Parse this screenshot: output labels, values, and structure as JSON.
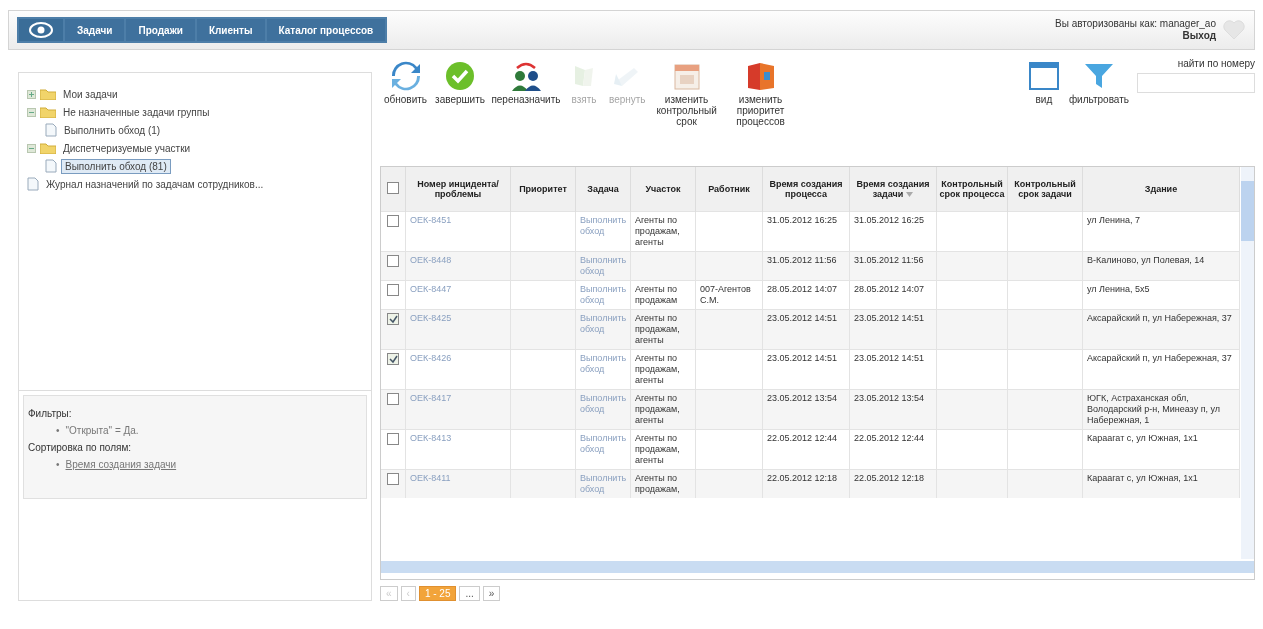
{
  "nav": {
    "tabs": [
      {
        "label": "Задачи",
        "selected": false
      },
      {
        "label": "Продажи",
        "selected": false
      },
      {
        "label": "Клиенты",
        "selected": false
      },
      {
        "label": "Каталог процессов",
        "selected": false
      }
    ]
  },
  "user": {
    "text": "Вы авторизованы как: manager_ao",
    "logout": "Выход"
  },
  "tree": [
    {
      "label": "Мои задачи",
      "kind": "folder",
      "expanded": false,
      "selected": false
    },
    {
      "label": "Не назначенные задачи группы",
      "kind": "folder",
      "expanded": true,
      "selected": false,
      "children": [
        {
          "label": "Выполнить обход (1)",
          "kind": "doc",
          "selected": false
        }
      ]
    },
    {
      "label": "Диспетчеризуемые участки",
      "kind": "folder",
      "expanded": true,
      "selected": false,
      "children": [
        {
          "label": "Выполнить обход (81)",
          "kind": "doc",
          "selected": true
        }
      ]
    },
    {
      "label": "Журнал назначений по задачам сотрудников...",
      "kind": "doc",
      "selected": false
    }
  ],
  "filters": {
    "title": "Фильтры:",
    "items": [
      {
        "marker": "•",
        "text": "\"Открыта\" = Да."
      }
    ],
    "sort_title": "Сортировка по полям:",
    "sort_items": [
      {
        "marker": "•",
        "text": "Время создания задачи"
      }
    ]
  },
  "toolbar": [
    {
      "label": "обновить",
      "kind": "refresh",
      "disabled": false
    },
    {
      "label": "завершить",
      "kind": "done",
      "disabled": false
    },
    {
      "label": "переназначить",
      "kind": "reassign",
      "disabled": false
    },
    {
      "label": "взять",
      "kind": "take",
      "disabled": true
    },
    {
      "label": "вернуть",
      "kind": "return",
      "disabled": true
    },
    {
      "label": "изменить контрольный срок",
      "kind": "calendar",
      "disabled": false
    },
    {
      "label": "изменить приоритет процессов",
      "kind": "priority",
      "disabled": false
    }
  ],
  "toolbar_right": [
    {
      "label": "вид",
      "kind": "view",
      "disabled": false
    },
    {
      "label": "фильтровать",
      "kind": "filter",
      "disabled": false
    }
  ],
  "search": {
    "label": "найти по номеру"
  },
  "table": {
    "all_checked": false,
    "columns": [
      {
        "label": "Номер инцидента/проблемы",
        "sorted": false
      },
      {
        "label": "Приоритет",
        "sorted": false
      },
      {
        "label": "Задача",
        "sorted": false
      },
      {
        "label": "Участок",
        "sorted": false
      },
      {
        "label": "Работник",
        "sorted": false
      },
      {
        "label": "Время создания процесса",
        "sorted": false
      },
      {
        "label": "Время создания задачи",
        "sorted": true
      },
      {
        "label": "Контрольный срок процесса",
        "sorted": false
      },
      {
        "label": "Контрольный срок задачи",
        "sorted": false
      },
      {
        "label": "Здание",
        "sorted": false
      }
    ],
    "rows": [
      {
        "checked": false,
        "number": "ОЕК-8451",
        "task": "Выполнить обход",
        "section": "Агенты по продажам, агенты",
        "worker": "",
        "process_time": "31.05.2012 16:25",
        "task_time": "31.05.2012 16:25",
        "building": "ул Ленина, 7"
      },
      {
        "checked": false,
        "number": "ОЕК-8448",
        "task": "Выполнить обход",
        "section": "",
        "worker": "",
        "process_time": "31.05.2012 11:56",
        "task_time": "31.05.2012 11:56",
        "building": "В-Калиново, ул Полевая, 14"
      },
      {
        "checked": false,
        "number": "ОЕК-8447",
        "task": "Выполнить обход",
        "section": "Агенты по продажам",
        "worker": "007-Агентов С.М.",
        "process_time": "28.05.2012 14:07",
        "task_time": "28.05.2012 14:07",
        "building": "ул Ленина, 5х5"
      },
      {
        "checked": true,
        "number": "ОЕК-8425",
        "task": "Выполнить обход",
        "section": "Агенты по продажам, агенты",
        "worker": "",
        "process_time": "23.05.2012 14:51",
        "task_time": "23.05.2012 14:51",
        "building": "Аксарайский п, ул Набережная, 37"
      },
      {
        "checked": true,
        "number": "ОЕК-8426",
        "task": "Выполнить обход",
        "section": "Агенты по продажам, агенты",
        "worker": "",
        "process_time": "23.05.2012 14:51",
        "task_time": "23.05.2012 14:51",
        "building": "Аксарайский п, ул Набережная, 37"
      },
      {
        "checked": false,
        "number": "ОЕК-8417",
        "task": "Выполнить обход",
        "section": "Агенты по продажам, агенты",
        "worker": "",
        "process_time": "23.05.2012 13:54",
        "task_time": "23.05.2012 13:54",
        "building": "ЮГК, Астраханская обл, Володарский р-н, Минеазу п, ул Набережная, 1"
      },
      {
        "checked": false,
        "number": "ОЕК-8413",
        "task": "Выполнить обход",
        "section": "Агенты по продажам, агенты",
        "worker": "",
        "process_time": "22.05.2012 12:44",
        "task_time": "22.05.2012 12:44",
        "building": "Караагат с, ул Южная, 1х1"
      },
      {
        "checked": false,
        "number": "ОЕК-8411",
        "task": "Выполнить обход",
        "section": "Агенты по продажам,",
        "worker": "",
        "process_time": "22.05.2012 12:18",
        "task_time": "22.05.2012 12:18",
        "building": "Караагат с, ул Южная, 1х1"
      }
    ]
  },
  "pager": [
    {
      "label": "«",
      "disabled": true,
      "selected": false
    },
    {
      "label": "‹",
      "disabled": true,
      "selected": false
    },
    {
      "label": "1 - 25",
      "disabled": false,
      "selected": true
    },
    {
      "label": "...",
      "disabled": false,
      "selected": false
    },
    {
      "label": "»",
      "disabled": false,
      "selected": false
    }
  ]
}
